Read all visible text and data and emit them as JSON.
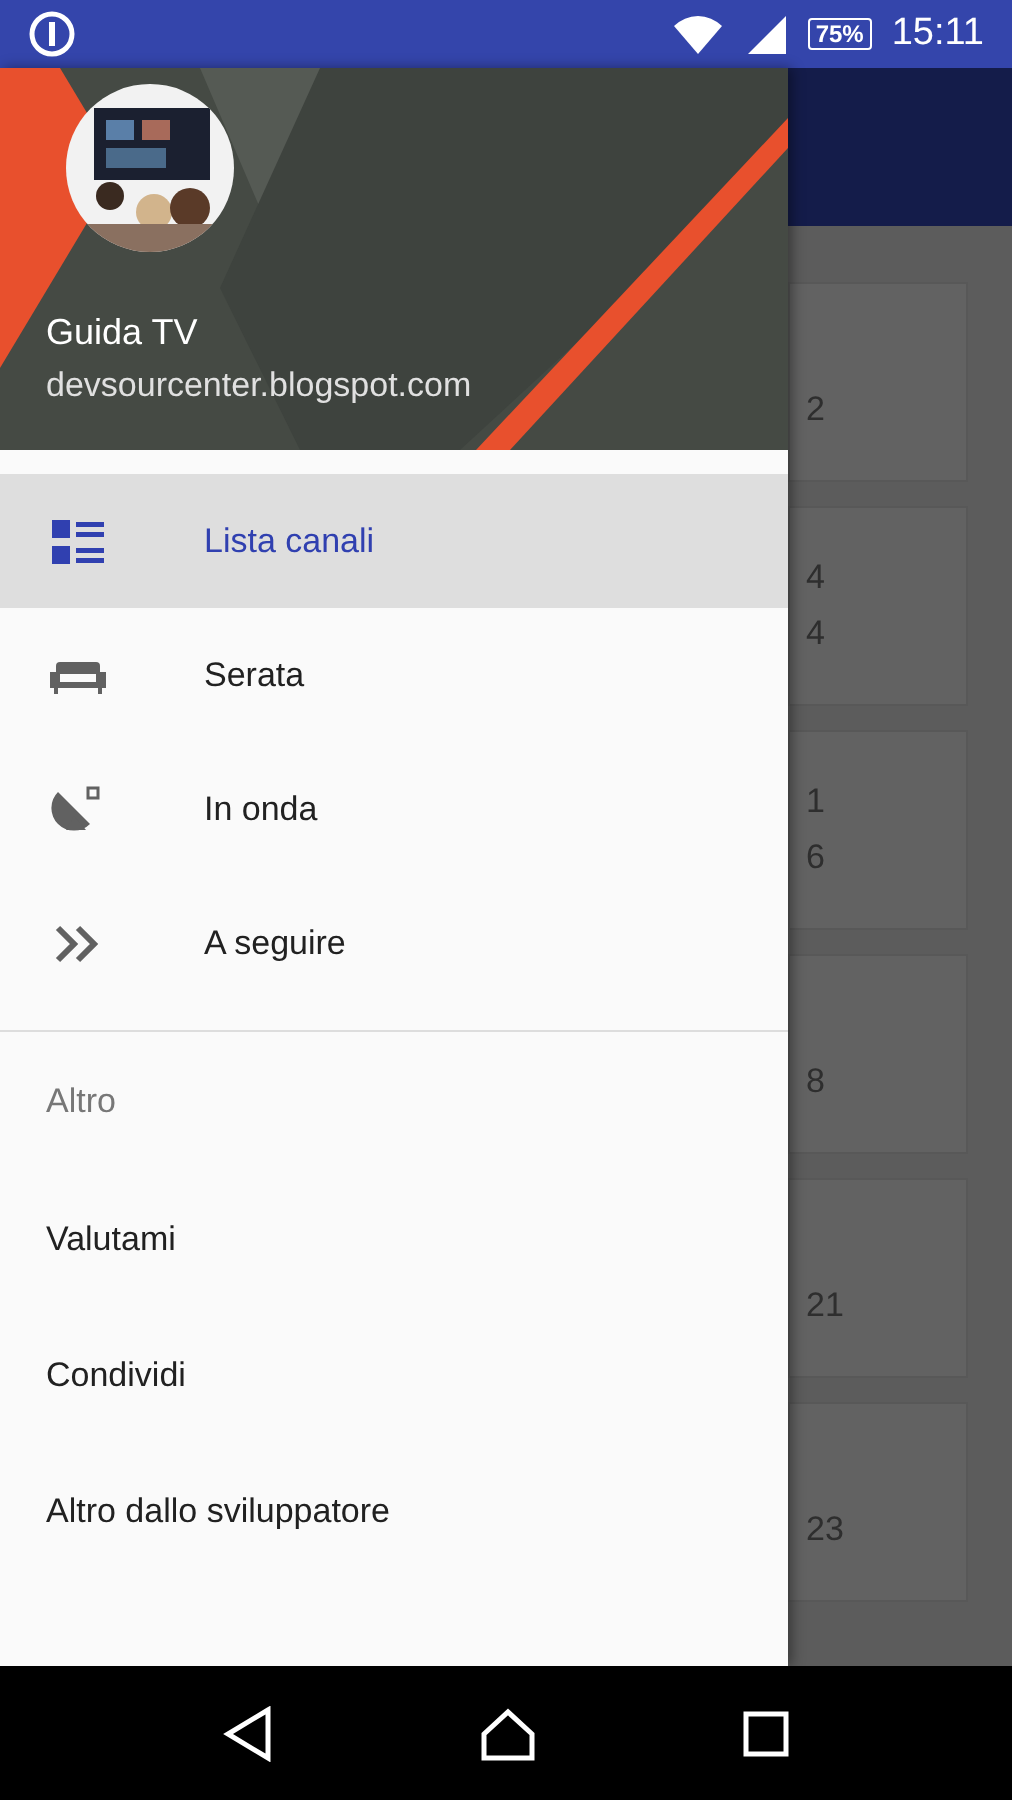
{
  "status_bar": {
    "battery": "75%",
    "time": "15:11"
  },
  "drawer": {
    "header": {
      "title": "Guida TV",
      "subtitle": "devsourcenter.blogspot.com"
    },
    "items": [
      {
        "label": "Lista canali",
        "kind": "list",
        "selected": true
      },
      {
        "label": "Serata",
        "kind": "sofa",
        "selected": false
      },
      {
        "label": "In onda",
        "kind": "satellite",
        "selected": false
      },
      {
        "label": "A seguire",
        "kind": "chevrons",
        "selected": false
      }
    ],
    "section_title": "Altro",
    "links": [
      "Valutami",
      "Condividi",
      "Altro dallo sviluppatore"
    ]
  },
  "background_cards": [
    {
      "line_2": "2"
    },
    {
      "line_1": "4",
      "line_2": "4"
    },
    {
      "line_1": "1",
      "line_2": "6"
    },
    {
      "line_2": "8"
    },
    {
      "line_2": "21"
    },
    {
      "line_2": "23"
    }
  ]
}
